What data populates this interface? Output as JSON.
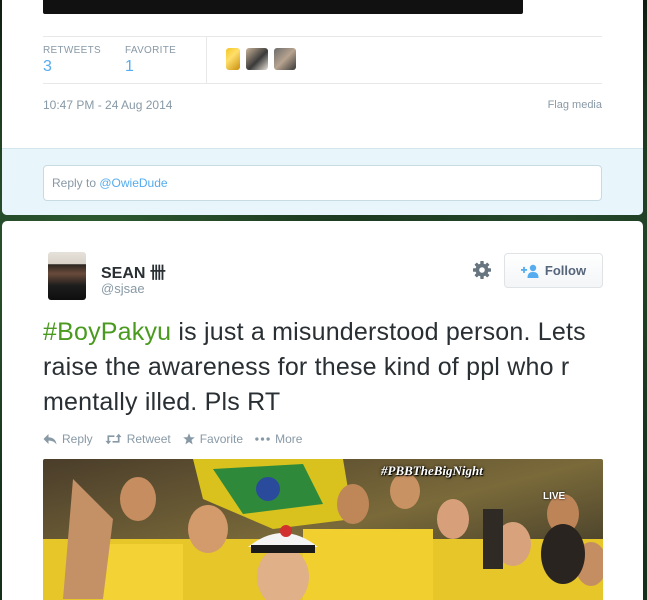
{
  "tweet1": {
    "retweets_label": "RETWEETS",
    "retweets_count": "3",
    "favorites_label": "FAVORITE",
    "favorites_count": "1",
    "timestamp": "10:47 PM - 24 Aug 2014",
    "flag_media": "Flag media",
    "reply_prefix": "Reply to ",
    "reply_mention": "@OwieDude"
  },
  "tweet2": {
    "author_name": "SEAN",
    "author_name_glyph": "卌",
    "author_handle": "@sjsae",
    "follow_label": "Follow",
    "hashtag": "#BoyPakyu",
    "text": " is just a misunderstood person. Lets raise the awareness for these kind of ppl who r mentally illed. Pls RT",
    "actions": {
      "reply": "Reply",
      "retweet": "Retweet",
      "favorite": "Favorite",
      "more": "More"
    },
    "media_hashtag": "#PBBTheBigNight",
    "media_badge": "LIVE"
  },
  "colors": {
    "link_blue": "#55acee",
    "hashtag_green": "#4a9a1f",
    "muted_gray": "#8899a6",
    "text_dark": "#292f33",
    "reply_area_bg": "#e8f5fa"
  },
  "icons": [
    "gear-icon",
    "follow-person-plus-icon",
    "reply-arrow-icon",
    "retweet-icon",
    "favorite-star-icon",
    "more-dots-icon"
  ]
}
